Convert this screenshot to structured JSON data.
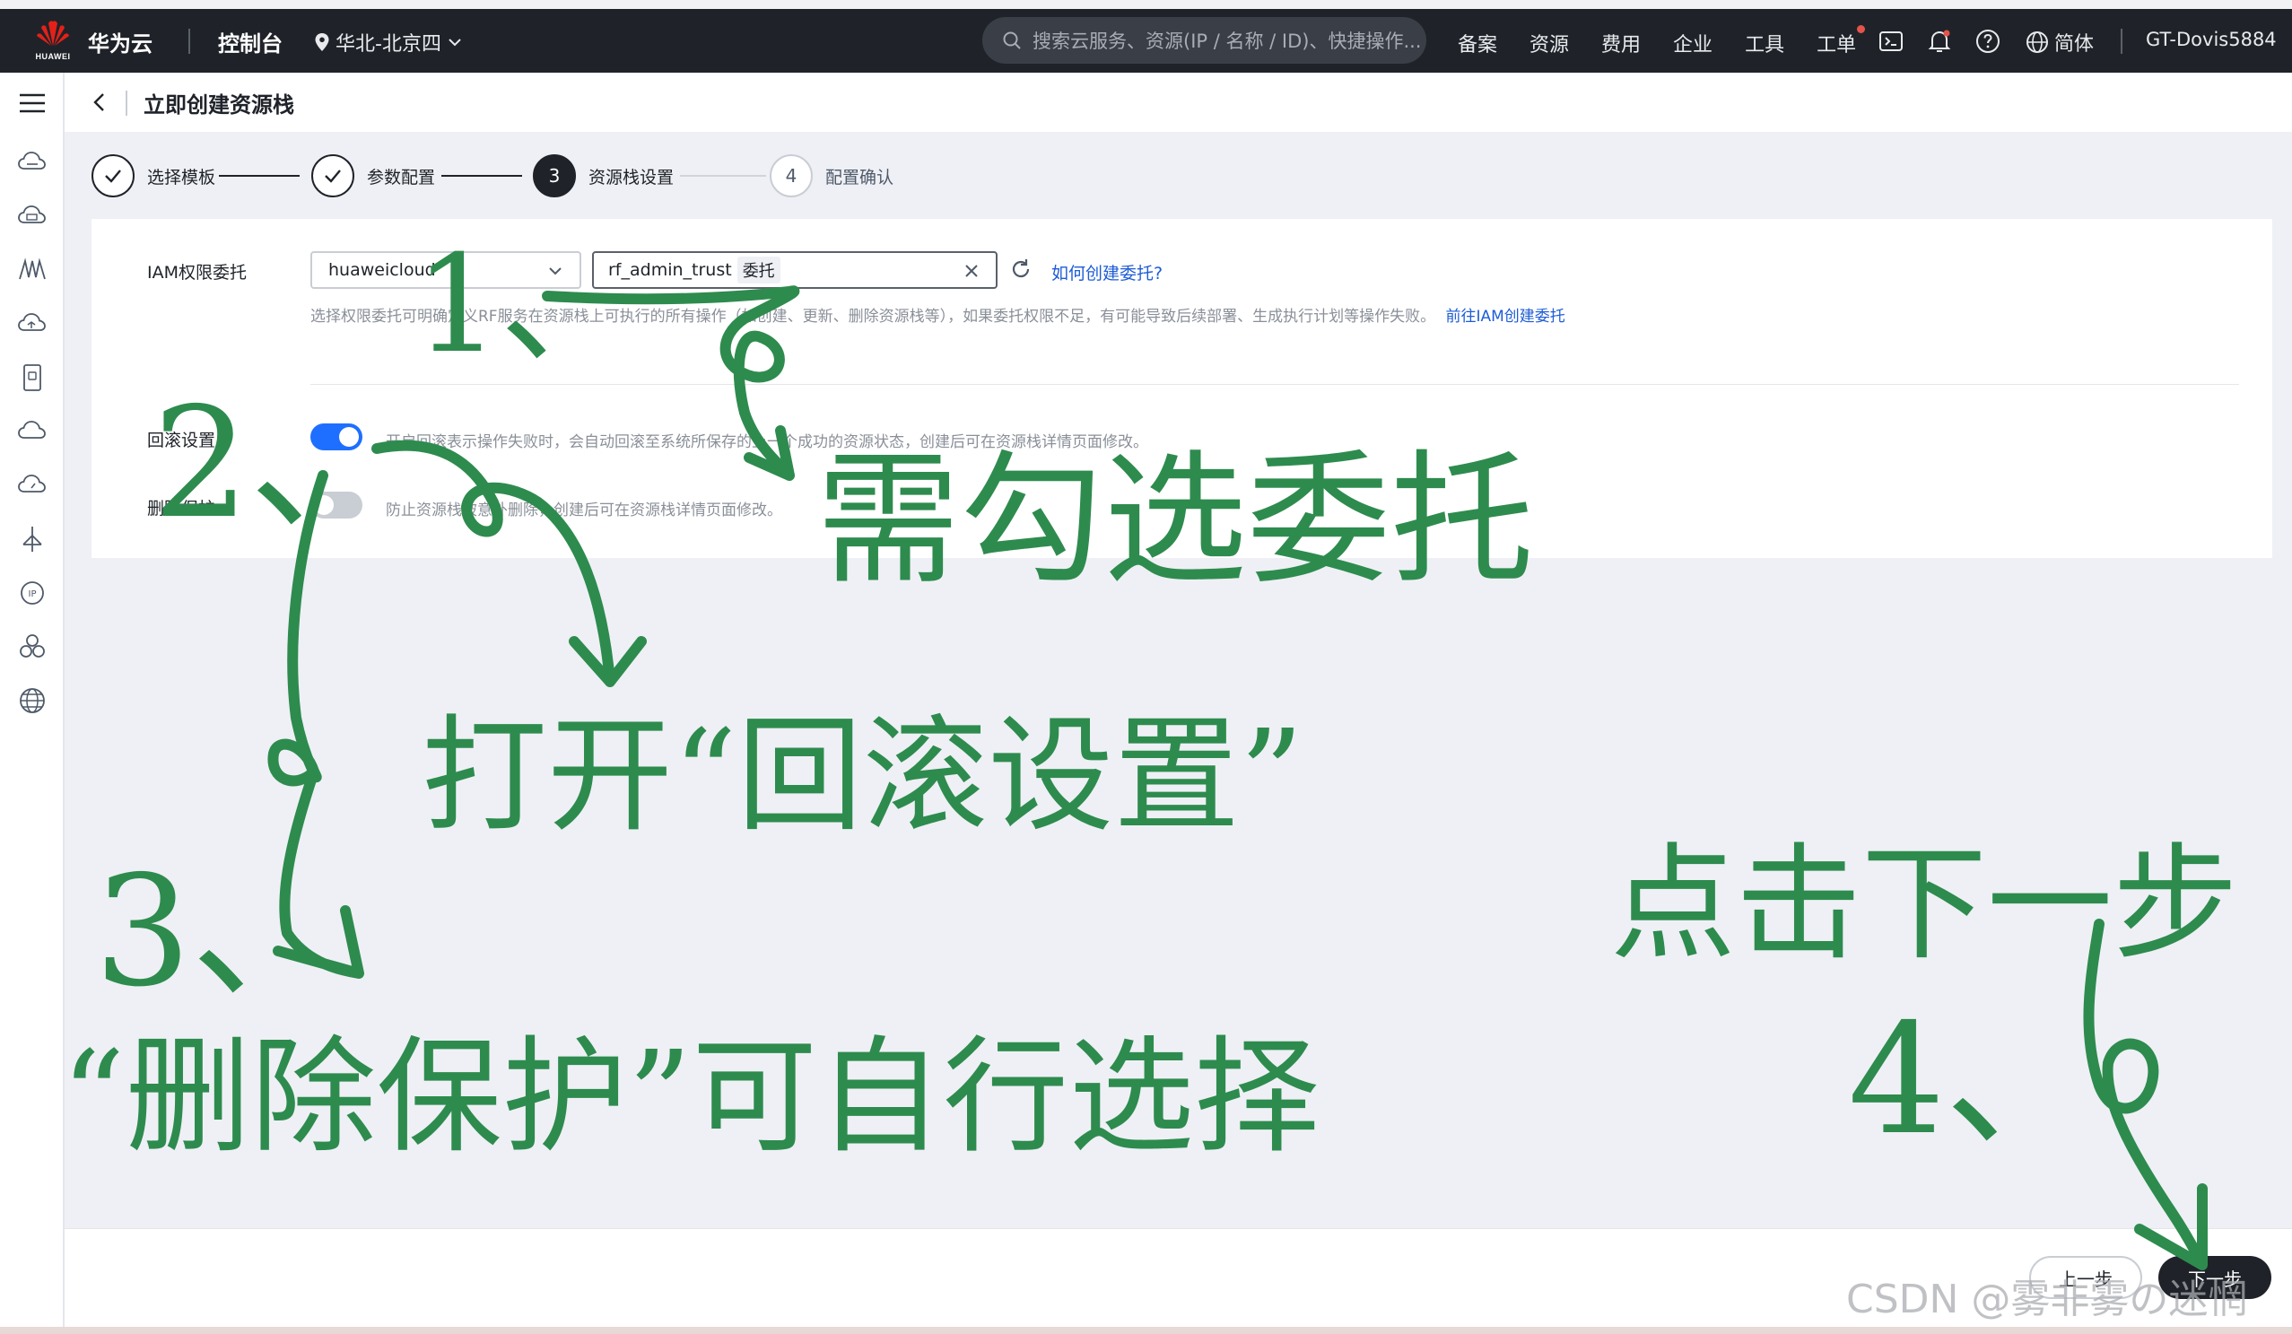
{
  "navbar": {
    "logo_text": "HUAWEI",
    "brand": "华为云",
    "console": "控制台",
    "region": "华北-北京四",
    "search_placeholder": "搜索云服务、资源(IP / 名称 / ID)、快捷操作...",
    "links": [
      "备案",
      "资源",
      "费用",
      "企业",
      "工具",
      "工单"
    ],
    "lang": "简体",
    "user": "GT-Dovis5884"
  },
  "sidebar": {
    "icons": [
      "menu-icon",
      "cloud-server-icon",
      "cloud-disk-icon",
      "monitor-wave-icon",
      "cloud-sync-icon",
      "storage-icon",
      "cloud-icon",
      "cloud-dashboard-icon",
      "network-icon",
      "ip-icon",
      "cluster-icon",
      "globe-icon"
    ]
  },
  "page": {
    "title": "立即创建资源栈"
  },
  "steps": [
    {
      "num": "✓",
      "label": "选择模板",
      "state": "done"
    },
    {
      "num": "✓",
      "label": "参数配置",
      "state": "done"
    },
    {
      "num": "3",
      "label": "资源栈设置",
      "state": "active"
    },
    {
      "num": "4",
      "label": "配置确认",
      "state": "todo"
    }
  ],
  "form": {
    "iam_label": "IAM权限委托",
    "iam_provider": "huaweicloud",
    "iam_agency": "rf_admin_trust",
    "iam_agency_tag": "委托",
    "how_link": "如何创建委托?",
    "iam_hint": "选择权限委托可明确定义RF服务在资源栈上可执行的所有操作（如创建、更新、删除资源栈等），如果委托权限不足，有可能导致后续部署、生成执行计划等操作失败。",
    "iam_hint_link": "前往IAM创建委托",
    "rollback_label": "回滚设置",
    "rollback_hint": "开启回滚表示操作失败时，会自动回滚至系统所保存的上一个成功的资源状态，创建后可在资源栈详情页面修改。",
    "rollback_on": true,
    "protect_label": "删除保护",
    "protect_hint": "防止资源栈被意外删除，创建后可在资源栈详情页面修改。",
    "protect_on": false
  },
  "footer": {
    "prev": "上一步",
    "next": "下一步"
  },
  "annotations": {
    "a1_num": "1、",
    "a1_text": "需勾选委托",
    "a2_num": "2、",
    "a2_text": "打开“回滚设置”",
    "a3_num": "3、",
    "a3_text": "“删除保护”可自行选择",
    "a4_text": "点击下一步",
    "a4_num": "4、"
  },
  "watermark": "CSDN @雾非雾の迷惘",
  "colors": {
    "navbar": "#1f2329",
    "accent": "#1e6fff",
    "link": "#1d5cd6",
    "annotation": "#2e8b4e",
    "content_bg": "#eef0f5"
  }
}
